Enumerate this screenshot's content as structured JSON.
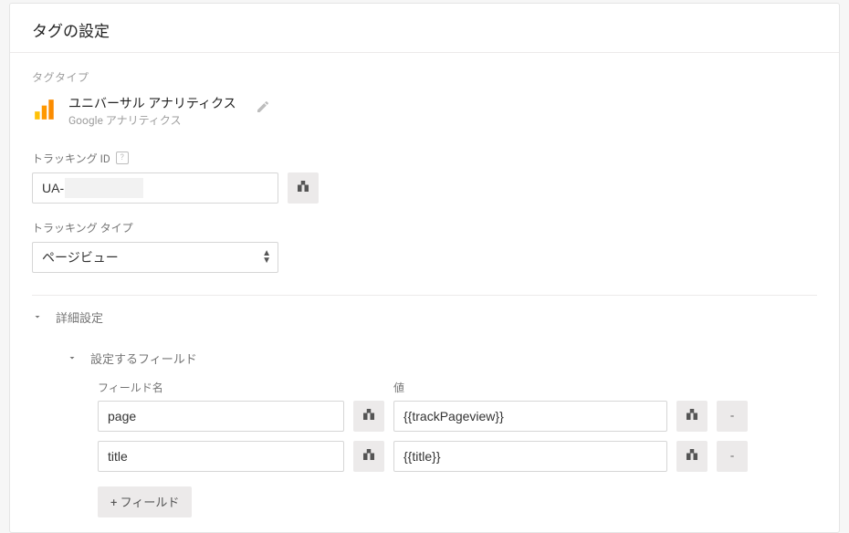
{
  "header": {
    "title": "タグの設定"
  },
  "tag_type": {
    "section_label": "タグタイプ",
    "name": "ユニバーサル アナリティクス",
    "provider": "Google アナリティクス"
  },
  "tracking_id": {
    "label": "トラッキング ID",
    "value": "UA-"
  },
  "tracking_type": {
    "label": "トラッキング タイプ",
    "options": [
      "ページビュー"
    ],
    "selected": "ページビュー"
  },
  "advanced": {
    "label": "詳細設定",
    "field_section_label": "設定するフィールド",
    "columns": {
      "name": "フィールド名",
      "value": "値"
    },
    "fields": [
      {
        "name": "page",
        "value": "{{trackPageview}}"
      },
      {
        "name": "title",
        "value": "{{title}}"
      }
    ],
    "add_label": "+ フィールド",
    "remove_label": "-"
  },
  "icons": {
    "help": "?"
  }
}
